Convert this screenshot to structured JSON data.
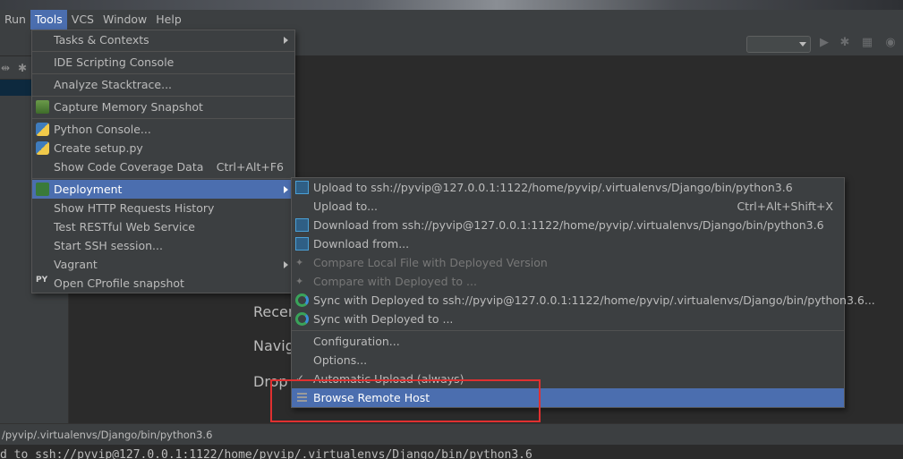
{
  "menubar": {
    "items": [
      {
        "label": "Run",
        "underline": "R"
      },
      {
        "label": "Tools",
        "underline": "T"
      },
      {
        "label": "VCS",
        "underline": "S"
      },
      {
        "label": "Window",
        "underline": "W"
      },
      {
        "label": "Help",
        "underline": "H"
      }
    ]
  },
  "tools_menu": {
    "items": [
      {
        "label": "Tasks & Contexts",
        "submenu": true
      },
      {
        "label": "IDE Scripting Console"
      },
      {
        "label": "Analyze Stacktrace..."
      },
      {
        "label": "Capture Memory Snapshot",
        "icon": "capture-memory-icon"
      },
      {
        "label": "Python Console...",
        "icon": "python-icon"
      },
      {
        "label": "Create setup.py",
        "icon": "python-setup-icon"
      },
      {
        "label": "Show Code Coverage Data",
        "shortcut": "Ctrl+Alt+F6"
      },
      {
        "label": "Deployment",
        "submenu": true,
        "icon": "deployment-icon",
        "selected": true
      },
      {
        "label": "Show HTTP Requests History"
      },
      {
        "label": "Test RESTful Web Service"
      },
      {
        "label": "Start SSH session..."
      },
      {
        "label": "Vagrant",
        "submenu": true
      },
      {
        "label": "Open CProfile snapshot",
        "icon": "py-profile-icon",
        "icon_text": "PY"
      }
    ]
  },
  "deployment_menu": {
    "items": [
      {
        "label": "Upload to ssh://pyvip@127.0.0.1:1122/home/pyvip/.virtualenvs/Django/bin/python3.6",
        "icon": "upload-icon"
      },
      {
        "label": "Upload to...",
        "shortcut": "Ctrl+Alt+Shift+X"
      },
      {
        "label": "Download from ssh://pyvip@127.0.0.1:1122/home/pyvip/.virtualenvs/Django/bin/python3.6",
        "icon": "download-icon"
      },
      {
        "label": "Download from...",
        "icon": "download-icon"
      },
      {
        "label": "Compare Local File with Deployed Version",
        "disabled": true,
        "icon": "compare-icon"
      },
      {
        "label": "Compare with Deployed to ...",
        "disabled": true,
        "icon": "compare-icon"
      },
      {
        "label": "Sync with Deployed to ssh://pyvip@127.0.0.1:1122/home/pyvip/.virtualenvs/Django/bin/python3.6...",
        "icon": "sync-icon"
      },
      {
        "label": "Sync with Deployed to ...",
        "icon": "sync-icon"
      },
      {
        "label": "Configuration..."
      },
      {
        "label": "Options..."
      },
      {
        "label": "Automatic Upload (always)",
        "checked": true
      },
      {
        "label": "Browse Remote Host",
        "icon": "remote-host-icon",
        "selected": true
      }
    ]
  },
  "editor": {
    "hint_recent": "Recen",
    "hint_navigate": "Navig",
    "hint_drop": "Drop"
  },
  "statusbar": {
    "text": "/pyvip/.virtualenvs/Django/bin/python3.6"
  },
  "console": {
    "text": "d to ssh://pyvip@127.0.0.1:1122/home/pyvip/.virtualenvs/Django/bin/python3.6"
  },
  "colors": {
    "selection": "#4b6eaf",
    "highlight_box": "#e03030"
  }
}
